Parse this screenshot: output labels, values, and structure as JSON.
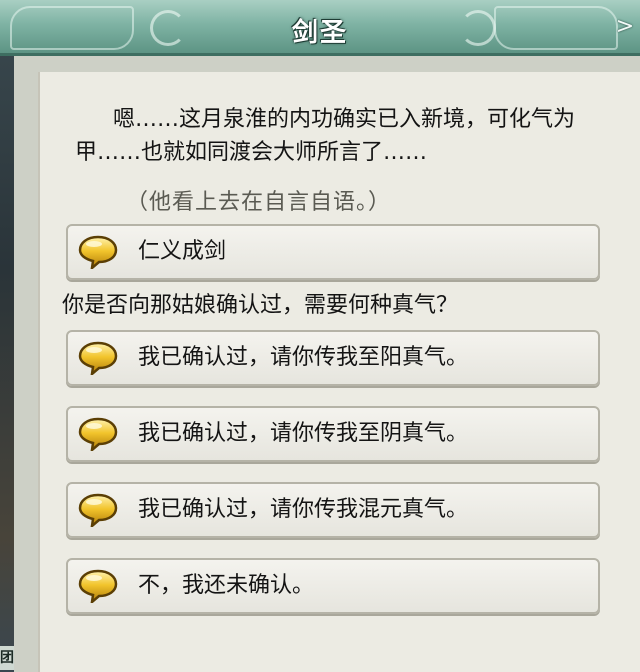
{
  "window": {
    "title": "剑圣",
    "close_label": ">"
  },
  "side_tag": "团",
  "dialog": {
    "speech": "嗯……这月泉淮的内功确实已入新境，可化气为甲……也就如同渡会大师所言了……",
    "aside": "（他看上去在自言自语。）",
    "first_option": "仁义成剑",
    "question": "你是否向那姑娘确认过，需要何种真气？",
    "options": [
      "我已确认过，请你传我至阳真气。",
      "我已确认过，请你传我至阴真气。",
      "我已确认过，请你传我混元真气。",
      "不，我还未确认。"
    ]
  },
  "icons": {
    "option_bubble": "speech-bubble-icon",
    "close": "close-icon"
  },
  "colors": {
    "title_bar": "#7fb3a4",
    "panel": "#ecebe3",
    "bubble": "#e8b21a"
  }
}
